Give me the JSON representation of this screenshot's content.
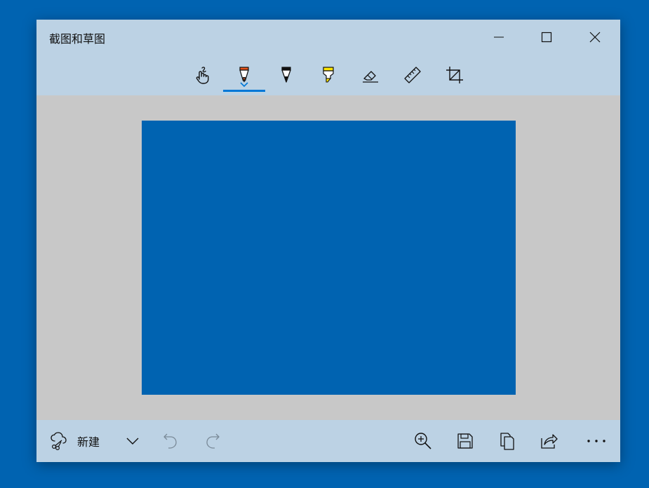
{
  "window": {
    "title": "截图和草图"
  },
  "titlebar": {
    "minimize_icon": "minimize-icon",
    "maximize_icon": "maximize-icon",
    "close_icon": "close-icon"
  },
  "toolbar": {
    "tools": [
      {
        "name": "touch-writing",
        "icon": "touch-writing-icon"
      },
      {
        "name": "ballpoint-pen",
        "icon": "ballpoint-pen-icon",
        "selected": true,
        "color": "#e8541c"
      },
      {
        "name": "pencil",
        "icon": "pencil-icon",
        "color": "#111111"
      },
      {
        "name": "highlighter",
        "icon": "highlighter-icon",
        "color": "#ffe600"
      },
      {
        "name": "eraser",
        "icon": "eraser-icon"
      },
      {
        "name": "ruler",
        "icon": "ruler-icon"
      },
      {
        "name": "image-crop",
        "icon": "crop-icon"
      }
    ]
  },
  "canvas": {
    "background": "#c8c8c8",
    "capture_color": "#0063b1"
  },
  "bottombar": {
    "new_label": "新建",
    "new_icon": "new-snip-icon",
    "dropdown_icon": "chevron-down-icon",
    "undo_icon": "undo-icon",
    "redo_icon": "redo-icon",
    "zoom_icon": "zoom-in-icon",
    "save_icon": "save-icon",
    "copy_icon": "copy-icon",
    "share_icon": "share-icon",
    "more_icon": "more-icon"
  },
  "colors": {
    "accent": "#0078d7",
    "desktop": "#0063b1",
    "chrome": "#bcd2e4"
  }
}
